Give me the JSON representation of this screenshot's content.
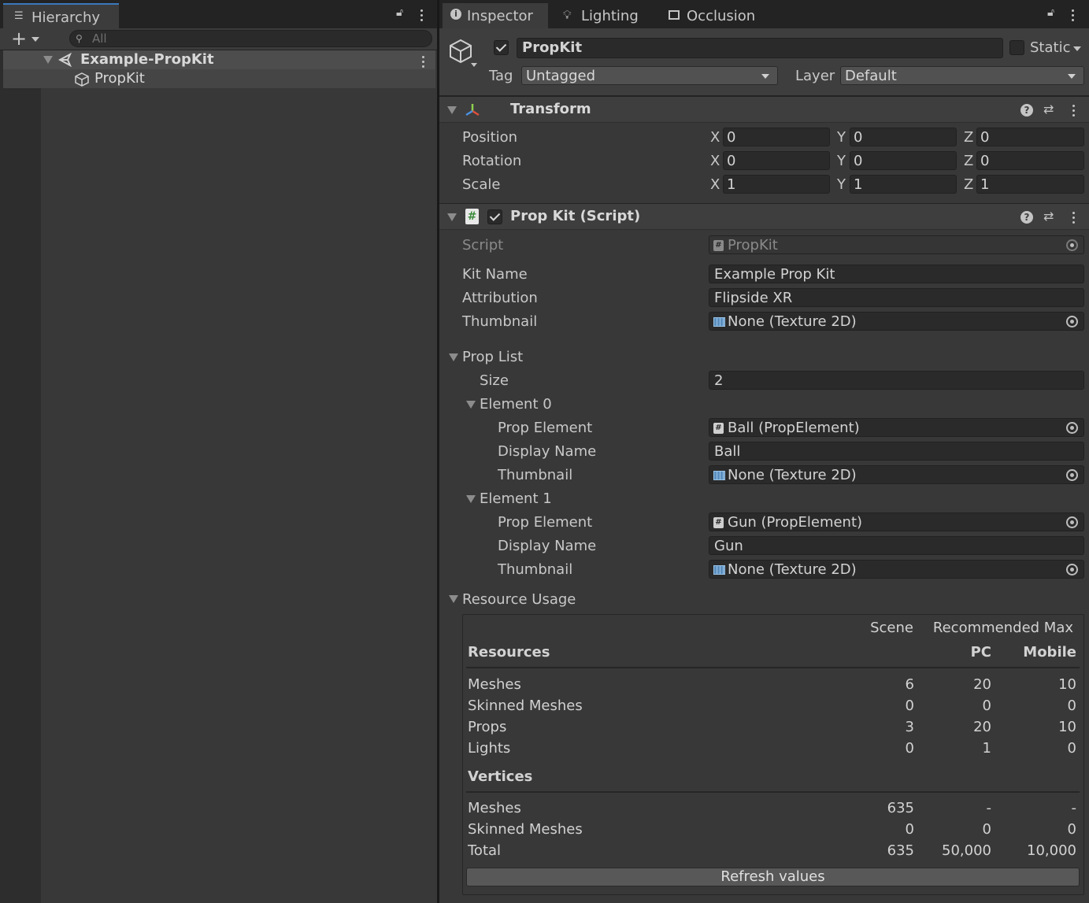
{
  "hierarchy": {
    "tab_label": "Hierarchy",
    "search_placeholder": "All",
    "scene_name": "Example-PropKit",
    "items": [
      "PropKit"
    ]
  },
  "inspector": {
    "tabs": [
      "Inspector",
      "Lighting",
      "Occlusion"
    ],
    "object": {
      "name": "PropKit",
      "active": true,
      "static_label": "Static",
      "tag_label": "Tag",
      "tag_value": "Untagged",
      "layer_label": "Layer",
      "layer_value": "Default"
    },
    "transform": {
      "title": "Transform",
      "rows": [
        {
          "label": "Position",
          "x": "0",
          "y": "0",
          "z": "0"
        },
        {
          "label": "Rotation",
          "x": "0",
          "y": "0",
          "z": "0"
        },
        {
          "label": "Scale",
          "x": "1",
          "y": "1",
          "z": "1"
        }
      ],
      "axis_x": "X",
      "axis_y": "Y",
      "axis_z": "Z"
    },
    "propkit": {
      "title": "Prop Kit (Script)",
      "script_label": "Script",
      "script_value": "PropKit",
      "kit_name_label": "Kit Name",
      "kit_name_value": "Example Prop Kit",
      "attribution_label": "Attribution",
      "attribution_value": "Flipside XR",
      "thumbnail_label": "Thumbnail",
      "thumbnail_value": "None (Texture 2D)",
      "prop_list_label": "Prop List",
      "size_label": "Size",
      "size_value": "2",
      "elements": [
        {
          "label": "Element 0",
          "prop_element_label": "Prop Element",
          "prop_element_value": "Ball (PropElement)",
          "display_name_label": "Display Name",
          "display_name_value": "Ball",
          "thumbnail_label": "Thumbnail",
          "thumbnail_value": "None (Texture 2D)"
        },
        {
          "label": "Element 1",
          "prop_element_label": "Prop Element",
          "prop_element_value": "Gun (PropElement)",
          "display_name_label": "Display Name",
          "display_name_value": "Gun",
          "thumbnail_label": "Thumbnail",
          "thumbnail_value": "None (Texture 2D)"
        }
      ]
    },
    "resource_usage": {
      "title": "Resource Usage",
      "col_scene": "Scene",
      "col_recommended": "Recommended Max",
      "col_pc": "PC",
      "col_mobile": "Mobile",
      "resources_heading": "Resources",
      "resources": [
        {
          "label": "Meshes",
          "scene": "6",
          "pc": "20",
          "mobile": "10"
        },
        {
          "label": "Skinned Meshes",
          "scene": "0",
          "pc": "0",
          "mobile": "0"
        },
        {
          "label": "Props",
          "scene": "3",
          "pc": "20",
          "mobile": "10"
        },
        {
          "label": "Lights",
          "scene": "0",
          "pc": "1",
          "mobile": "0"
        }
      ],
      "vertices_heading": "Vertices",
      "vertices": [
        {
          "label": "Meshes",
          "scene": "635",
          "pc": "-",
          "mobile": "-"
        },
        {
          "label": "Skinned Meshes",
          "scene": "0",
          "pc": "0",
          "mobile": "0"
        },
        {
          "label": "Total",
          "scene": "635",
          "pc": "50,000",
          "mobile": "10,000"
        }
      ],
      "refresh_label": "Refresh values"
    }
  },
  "icons": [
    "hierarchy-list-icon",
    "lock-icon",
    "kebab-menu-icon",
    "plus-icon",
    "search-icon",
    "unity-scene-icon",
    "gameobject-cube-icon",
    "info-icon",
    "lightbulb-icon",
    "occlusion-icon",
    "transform-axes-icon",
    "script-hash-icon",
    "help-icon",
    "preset-icon",
    "object-picker-icon",
    "texture-icon"
  ]
}
